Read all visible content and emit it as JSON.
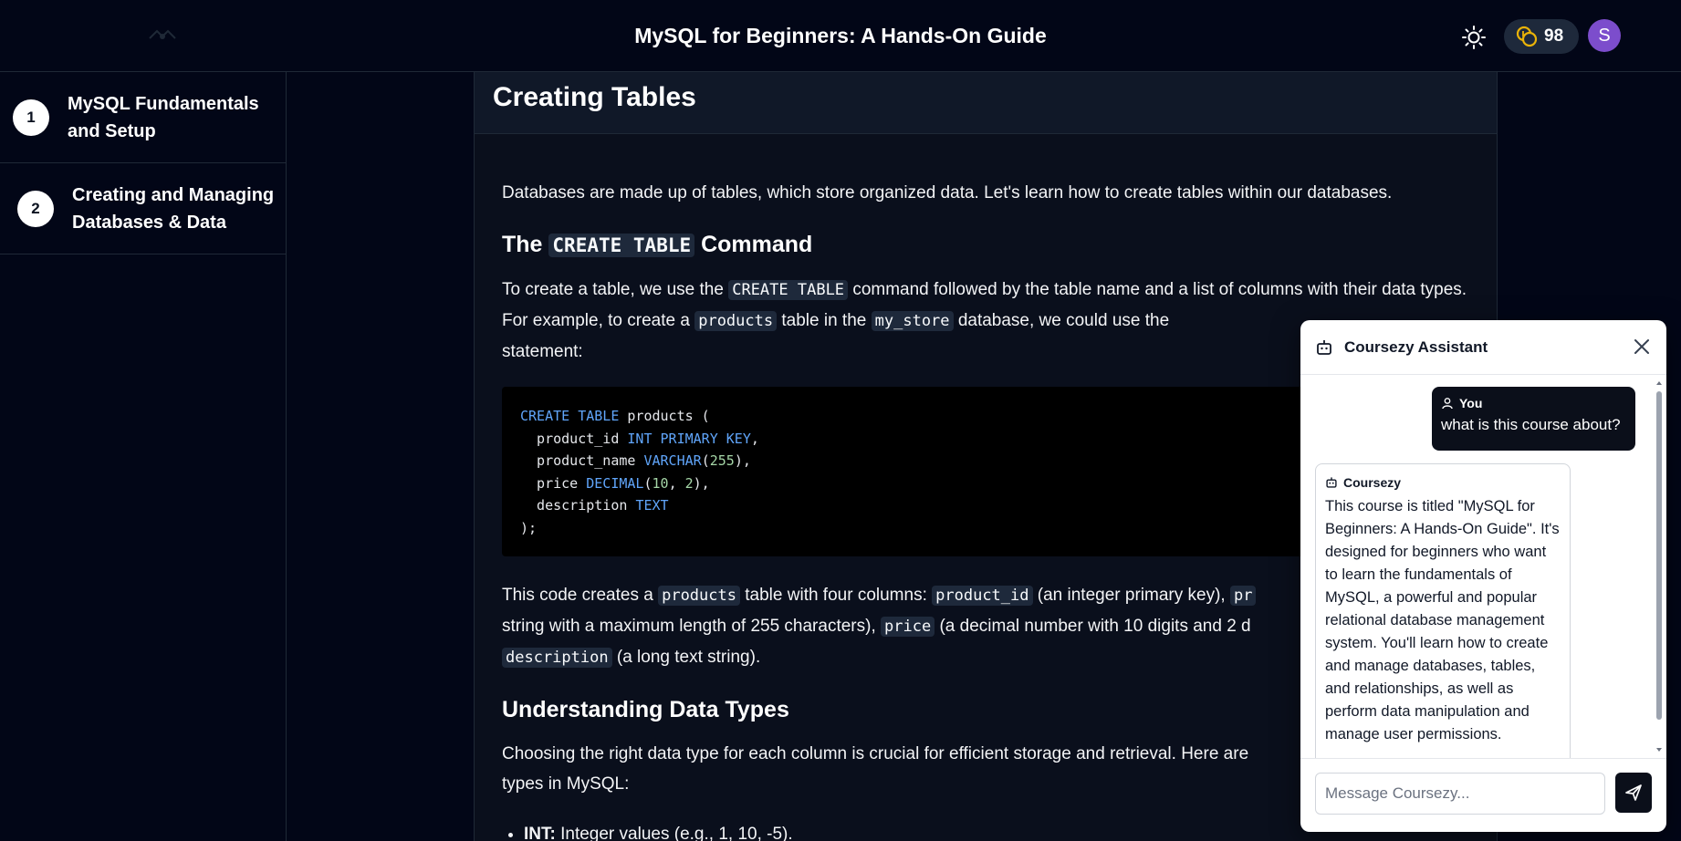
{
  "header": {
    "title": "MySQL for Beginners: A Hands-On Guide",
    "coins": "98",
    "avatar_initial": "S"
  },
  "sidebar": {
    "modules": [
      {
        "number": "1",
        "label": "MySQL Fundamentals and Setup"
      },
      {
        "number": "2",
        "label": "Creating and Managing Databases & Data"
      }
    ]
  },
  "lesson": {
    "title": "Creating Tables",
    "intro": "Databases are made up of tables, which store organized data. Let's learn how to create tables within our databases.",
    "h2_create_pre": "The",
    "h2_create_code": "CREATE TABLE",
    "h2_create_post": "Command",
    "p2": {
      "t1": "To create a table, we use the",
      "c1": "CREATE TABLE",
      "t2": "command followed by the table name and a list of columns with their data types. For example, to create a",
      "c2": "products",
      "t3": "table in the",
      "c3": "my_store",
      "t4": "database, we could use the",
      "t5": "statement:"
    },
    "code": {
      "l1_kw": "CREATE TABLE",
      "l1_rest": " products (",
      "l2_a": "  product_id ",
      "l2_kw": "INT PRIMARY KEY",
      "l2_b": ",",
      "l3_a": "  product_name ",
      "l3_kw": "VARCHAR",
      "l3_b": "(",
      "l3_n": "255",
      "l3_c": "),",
      "l4_a": "  price ",
      "l4_kw": "DECIMAL",
      "l4_b": "(",
      "l4_n1": "10",
      "l4_c": ", ",
      "l4_n2": "2",
      "l4_d": "),",
      "l5_a": "  description ",
      "l5_kw": "TEXT",
      "l6": ");"
    },
    "p3": {
      "t1": "This code creates a",
      "c1": "products",
      "t2": "table with four columns:",
      "c2": "product_id",
      "t3": "(an integer primary key),",
      "c3": "pr",
      "t4": "string with a maximum length of 255 characters),",
      "c4": "price",
      "t5": "(a decimal number with 10 digits and 2 d",
      "c5": "description",
      "t6": "(a long text string)."
    },
    "h2_types": "Understanding Data Types",
    "p4_a": "Choosing the right data type for each column is crucial for efficient storage and retrieval. Here are",
    "p4_b": "types in MySQL:",
    "li1_term": "INT:",
    "li1_text": " Integer values (e.g., 1, 10, -5)."
  },
  "chat": {
    "title": "Coursezy Assistant",
    "user_label": "You",
    "user_message": "what is this course about?",
    "bot_label": "Coursezy",
    "bot_message": "This course is titled \"MySQL for Beginners: A Hands-On Guide\". It's designed for beginners who want to learn the fundamentals of MySQL, a powerful and popular relational database management system. You'll learn how to create and manage databases, tables, and relationships, as well as perform data manipulation and manage user permissions.",
    "input_placeholder": "Message Coursezy..."
  },
  "icons": {
    "logo": "logo-icon",
    "theme": "sun-icon",
    "coins": "coins-icon",
    "bot": "bot-icon",
    "user": "user-icon",
    "close": "close-icon",
    "send": "send-icon"
  },
  "colors": {
    "background": "#020617",
    "panel": "#0a0f1c",
    "coin_gold": "#eab308",
    "avatar": "#7c4dcc",
    "keyword": "#60a5fa"
  }
}
